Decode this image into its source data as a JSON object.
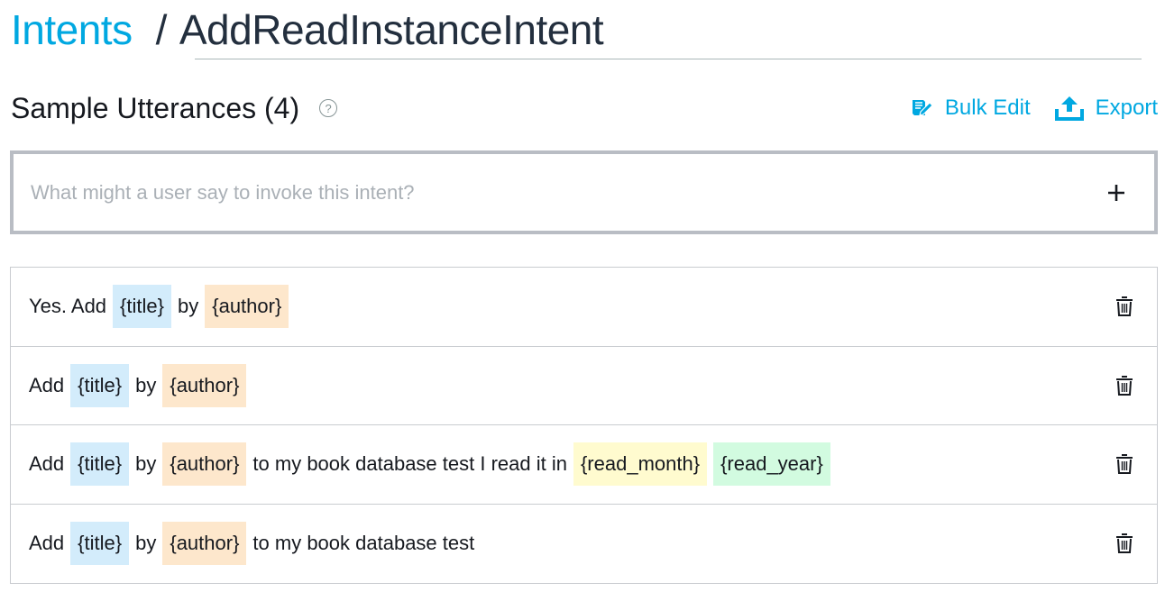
{
  "breadcrumb": {
    "parent": "Intents",
    "separator": "/",
    "current": "AddReadInstanceIntent"
  },
  "section": {
    "title": "Sample Utterances (4)",
    "help_icon": "question-circle-icon"
  },
  "actions": {
    "bulk_edit_label": "Bulk Edit",
    "bulk_edit_icon": "bulk-edit-icon",
    "export_label": "Export",
    "export_icon": "upload-icon"
  },
  "input": {
    "placeholder": "What might a user say to invoke this intent?",
    "value": "",
    "add_icon": "plus-icon"
  },
  "colors": {
    "link": "#00a8e1",
    "slot_title": "#d3ecfb",
    "slot_author": "#fde7cc",
    "slot_read_month": "#fffbcf",
    "slot_read_year": "#d2fbe0"
  },
  "utterances": [
    {
      "parts": [
        {
          "type": "text",
          "text": "Yes. Add"
        },
        {
          "type": "slot",
          "text": "{title}",
          "color": "blue"
        },
        {
          "type": "text",
          "text": "by"
        },
        {
          "type": "slot",
          "text": "{author}",
          "color": "orange"
        }
      ]
    },
    {
      "parts": [
        {
          "type": "text",
          "text": "Add"
        },
        {
          "type": "slot",
          "text": "{title}",
          "color": "blue"
        },
        {
          "type": "text",
          "text": "by"
        },
        {
          "type": "slot",
          "text": "{author}",
          "color": "orange"
        }
      ]
    },
    {
      "parts": [
        {
          "type": "text",
          "text": "Add"
        },
        {
          "type": "slot",
          "text": "{title}",
          "color": "blue"
        },
        {
          "type": "text",
          "text": "by"
        },
        {
          "type": "slot",
          "text": "{author}",
          "color": "orange"
        },
        {
          "type": "text",
          "text": "to my book database test I read it in"
        },
        {
          "type": "slot",
          "text": "{read_month}",
          "color": "yellow"
        },
        {
          "type": "slot",
          "text": "{read_year}",
          "color": "green"
        }
      ]
    },
    {
      "parts": [
        {
          "type": "text",
          "text": "Add"
        },
        {
          "type": "slot",
          "text": "{title}",
          "color": "blue"
        },
        {
          "type": "text",
          "text": "by"
        },
        {
          "type": "slot",
          "text": "{author}",
          "color": "orange"
        },
        {
          "type": "text",
          "text": "to my book database test"
        }
      ]
    }
  ]
}
